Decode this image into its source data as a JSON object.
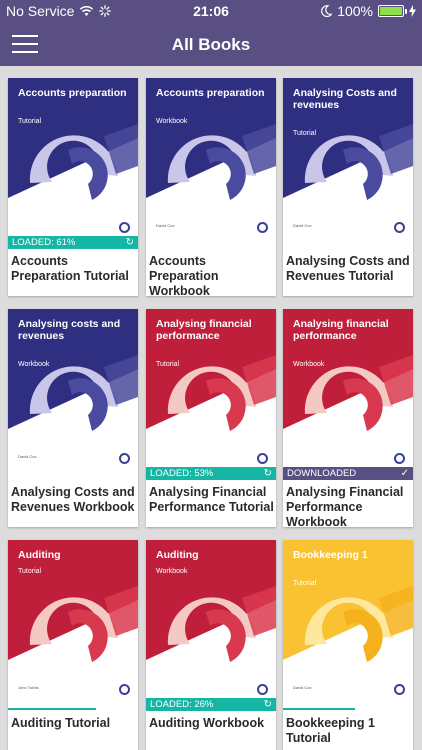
{
  "status_bar": {
    "carrier": "No Service",
    "time": "21:06",
    "battery": "100%",
    "wifi_icon": "wifi-icon",
    "activity_icon": "activity-spinner-icon",
    "moon_icon": "do-not-disturb-moon-icon",
    "charging_icon": "charging-bolt-icon"
  },
  "nav": {
    "title": "All Books",
    "menu_icon": "hamburger-menu-icon"
  },
  "colors": {
    "bar": "#5a4f83",
    "teal": "#16b6a5",
    "navy": "#2f2f82",
    "red": "#c01f3c",
    "yellow": "#f9c233"
  },
  "books": [
    {
      "cover_title": "Accounts preparation",
      "cover_sub": "Tutorial",
      "label": "Accounts Preparation Tutorial",
      "theme": "navy",
      "status": "LOADED: 61%",
      "status_type": "loaded",
      "progress": 0.61,
      "author": ""
    },
    {
      "cover_title": "Accounts preparation",
      "cover_sub": "Workbook",
      "label": "Accounts Preparation Workbook",
      "theme": "navy",
      "status": "",
      "status_type": "none",
      "author": "David Cox"
    },
    {
      "cover_title": "Analysing Costs and revenues",
      "cover_sub": "Tutorial",
      "label": "Analysing Costs and Revenues Tutorial",
      "theme": "navy",
      "status": "",
      "status_type": "none",
      "author": "David Cox"
    },
    {
      "cover_title": "Analysing costs and revenues",
      "cover_sub": "Workbook",
      "label": "Analysing Costs and Revenues Workbook",
      "theme": "navy",
      "status": "",
      "status_type": "none",
      "author": "David Cox"
    },
    {
      "cover_title": "Analysing financial performance",
      "cover_sub": "Tutorial",
      "label": "Analysing Financial Performance Tutorial",
      "theme": "red",
      "status": "LOADED: 53%",
      "status_type": "loaded",
      "progress": 0.53,
      "author": ""
    },
    {
      "cover_title": "Analysing financial performance",
      "cover_sub": "Workbook",
      "label": "Analysing Financial Performance Workbook",
      "theme": "red",
      "status": "DOWNLOADED",
      "status_type": "downloaded",
      "author": ""
    },
    {
      "cover_title": "Auditing",
      "cover_sub": "Tutorial",
      "label": "Auditing Tutorial",
      "theme": "red",
      "status": "",
      "status_type": "progress",
      "progress": 0.68,
      "author": "John Tubbs"
    },
    {
      "cover_title": "Auditing",
      "cover_sub": "Workbook",
      "label": "Auditing Workbook",
      "theme": "red",
      "status": "LOADED: 26%",
      "status_type": "loaded",
      "progress": 0.26,
      "author": ""
    },
    {
      "cover_title": "Bookkeeping 1",
      "cover_sub": "Tutorial",
      "label": "Bookkeeping 1 Tutorial",
      "theme": "yellow",
      "status": "",
      "status_type": "progress",
      "progress": 0.55,
      "author": "David Cox"
    }
  ]
}
